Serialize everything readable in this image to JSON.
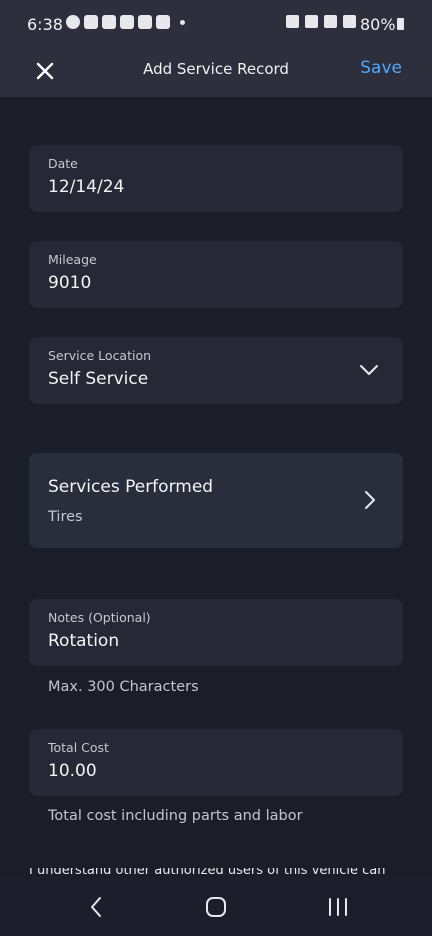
{
  "status_bar": {
    "time": "6:38",
    "battery": "80%"
  },
  "header": {
    "title": "Add Service Record",
    "save_label": "Save"
  },
  "form": {
    "date": {
      "label": "Date",
      "value": "12/14/24"
    },
    "mileage": {
      "label": "Mileage",
      "value": "9010"
    },
    "service_location": {
      "label": "Service Location",
      "value": "Self Service"
    },
    "services_performed": {
      "title": "Services Performed",
      "value": "Tires"
    },
    "notes": {
      "label": "Notes (Optional)",
      "value": "Rotation",
      "helper": "Max. 300 Characters"
    },
    "total_cost": {
      "label": "Total Cost",
      "value": "10.00",
      "helper": "Total cost including parts and labor"
    },
    "disclaimer": "I understand other authorized users of this vehicle can view"
  },
  "colors": {
    "accent": "#4fa7ff",
    "background": "#1b1e29",
    "card": "#262935"
  },
  "icons": {
    "close": "close-icon",
    "dropdown": "chevron-down-icon",
    "navigate": "chevron-right-icon",
    "back": "back-icon",
    "home": "home-icon",
    "recents": "recents-icon"
  }
}
